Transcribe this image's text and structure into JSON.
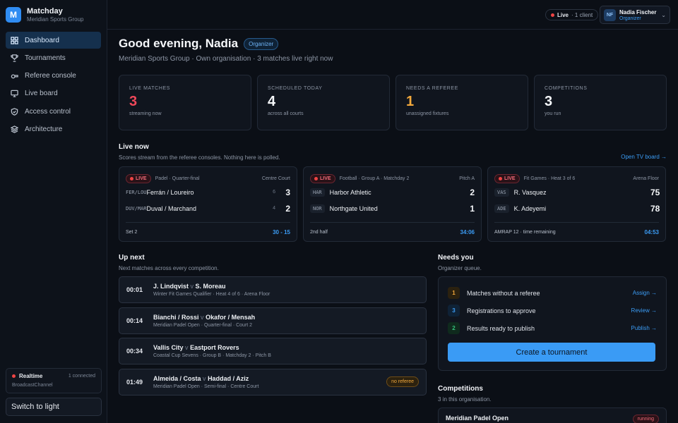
{
  "brand": {
    "logo": "M",
    "name": "Matchday",
    "org": "Meridian Sports Group"
  },
  "nav": [
    {
      "label": "Dashboard",
      "icon": "grid-icon",
      "active": true
    },
    {
      "label": "Tournaments",
      "icon": "trophy-icon",
      "active": false
    },
    {
      "label": "Referee console",
      "icon": "whistle-icon",
      "active": false
    },
    {
      "label": "Live board",
      "icon": "monitor-icon",
      "active": false
    },
    {
      "label": "Access control",
      "icon": "shield-icon",
      "active": false
    },
    {
      "label": "Architecture",
      "icon": "layers-icon",
      "active": false
    }
  ],
  "realtime": {
    "title": "Realtime",
    "connected": "1 connected",
    "channel": "BroadcastChannel"
  },
  "theme_toggle": "Switch to light",
  "topbar": {
    "live_label": "Live",
    "live_clients": "· 1 client"
  },
  "user": {
    "initials": "NF",
    "name": "Nadia Fischer",
    "role": "Organizer"
  },
  "greeting": {
    "title": "Good evening, Nadia",
    "badge": "Organizer",
    "subtitle": "Meridian Sports Group · Own organisation · 3 matches live right now"
  },
  "stats": [
    {
      "label": "LIVE MATCHES",
      "value": "3",
      "sub": "streaming now",
      "tone": "red"
    },
    {
      "label": "SCHEDULED TODAY",
      "value": "4",
      "sub": "across all courts",
      "tone": ""
    },
    {
      "label": "NEEDS A REFEREE",
      "value": "1",
      "sub": "unassigned fixtures",
      "tone": "amber"
    },
    {
      "label": "COMPETITIONS",
      "value": "3",
      "sub": "you run",
      "tone": ""
    }
  ],
  "live_now": {
    "title": "Live now",
    "subtitle": "Scores stream from the referee consoles. Nothing here is polled.",
    "link": "Open TV board →",
    "live_tag": "LIVE",
    "matches": [
      {
        "meta": "Padel · Quarter-final",
        "court": "Centre Court",
        "teams": [
          {
            "code": "FER/LOU",
            "name": "Ferrán / Loureiro",
            "sets": "6",
            "score": "3"
          },
          {
            "code": "DUV/MAR",
            "name": "Duval / Marchand",
            "sets": "4",
            "score": "2"
          }
        ],
        "phase": "Set 2",
        "clock": "30 - 15"
      },
      {
        "meta": "Football · Group A · Matchday 2",
        "court": "Pitch A",
        "teams": [
          {
            "code": "HAR",
            "name": "Harbor Athletic",
            "sets": "",
            "score": "2"
          },
          {
            "code": "NOR",
            "name": "Northgate United",
            "sets": "",
            "score": "1"
          }
        ],
        "phase": "2nd half",
        "clock": "34:06"
      },
      {
        "meta": "Fit Games · Heat 3 of 6",
        "court": "Arena Floor",
        "teams": [
          {
            "code": "VAS",
            "name": "R. Vasquez",
            "sets": "",
            "score": "75"
          },
          {
            "code": "ADE",
            "name": "K. Adeyemi",
            "sets": "",
            "score": "78"
          }
        ],
        "phase": "AMRAP 12 · time remaining",
        "clock": "04:53"
      }
    ]
  },
  "up_next": {
    "title": "Up next",
    "subtitle": "Next matches across every competition.",
    "items": [
      {
        "time": "00:01",
        "home": "J. Lindqvist",
        "away": "S. Moreau",
        "meta": "Winter Fit Games Qualifier · Heat 4 of 6 · Arena Floor",
        "flag": ""
      },
      {
        "time": "00:14",
        "home": "Bianchi / Rossi",
        "away": "Okafor / Mensah",
        "meta": "Meridian Padel Open · Quarter-final · Court 2",
        "flag": ""
      },
      {
        "time": "00:34",
        "home": "Vallis City",
        "away": "Eastport Rovers",
        "meta": "Coastal Cup Sevens · Group B · Matchday 2 · Pitch B",
        "flag": ""
      },
      {
        "time": "01:49",
        "home": "Almeida / Costa",
        "away": "Haddad / Aziz",
        "meta": "Meridian Padel Open · Semi-final · Centre Court",
        "flag": "no referee"
      }
    ],
    "vs": "v"
  },
  "needs_you": {
    "title": "Needs you",
    "subtitle": "Organizer queue.",
    "items": [
      {
        "count": "1",
        "label": "Matches without a referee",
        "action": "Assign →",
        "tone": "amber"
      },
      {
        "count": "3",
        "label": "Registrations to approve",
        "action": "Review →",
        "tone": "blue"
      },
      {
        "count": "2",
        "label": "Results ready to publish",
        "action": "Publish →",
        "tone": "green"
      }
    ],
    "cta": "Create a tournament"
  },
  "competitions": {
    "title": "Competitions",
    "subtitle": "3 in this organisation.",
    "first": {
      "name": "Meridian Padel Open",
      "status": "running"
    }
  }
}
